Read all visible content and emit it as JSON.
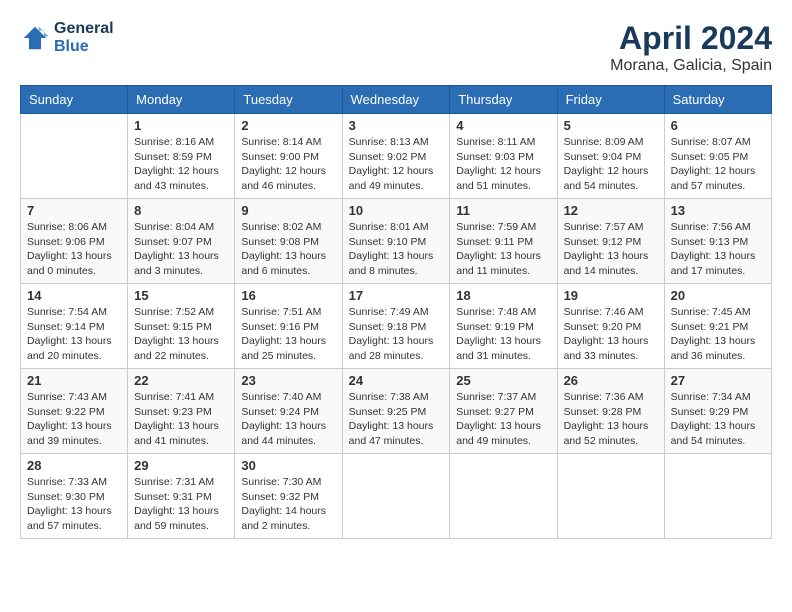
{
  "header": {
    "logo_line1": "General",
    "logo_line2": "Blue",
    "title": "April 2024",
    "location": "Morana, Galicia, Spain"
  },
  "days_of_week": [
    "Sunday",
    "Monday",
    "Tuesday",
    "Wednesday",
    "Thursday",
    "Friday",
    "Saturday"
  ],
  "weeks": [
    [
      {
        "day": "",
        "info": ""
      },
      {
        "day": "1",
        "info": "Sunrise: 8:16 AM\nSunset: 8:59 PM\nDaylight: 12 hours\nand 43 minutes."
      },
      {
        "day": "2",
        "info": "Sunrise: 8:14 AM\nSunset: 9:00 PM\nDaylight: 12 hours\nand 46 minutes."
      },
      {
        "day": "3",
        "info": "Sunrise: 8:13 AM\nSunset: 9:02 PM\nDaylight: 12 hours\nand 49 minutes."
      },
      {
        "day": "4",
        "info": "Sunrise: 8:11 AM\nSunset: 9:03 PM\nDaylight: 12 hours\nand 51 minutes."
      },
      {
        "day": "5",
        "info": "Sunrise: 8:09 AM\nSunset: 9:04 PM\nDaylight: 12 hours\nand 54 minutes."
      },
      {
        "day": "6",
        "info": "Sunrise: 8:07 AM\nSunset: 9:05 PM\nDaylight: 12 hours\nand 57 minutes."
      }
    ],
    [
      {
        "day": "7",
        "info": "Sunrise: 8:06 AM\nSunset: 9:06 PM\nDaylight: 13 hours\nand 0 minutes."
      },
      {
        "day": "8",
        "info": "Sunrise: 8:04 AM\nSunset: 9:07 PM\nDaylight: 13 hours\nand 3 minutes."
      },
      {
        "day": "9",
        "info": "Sunrise: 8:02 AM\nSunset: 9:08 PM\nDaylight: 13 hours\nand 6 minutes."
      },
      {
        "day": "10",
        "info": "Sunrise: 8:01 AM\nSunset: 9:10 PM\nDaylight: 13 hours\nand 8 minutes."
      },
      {
        "day": "11",
        "info": "Sunrise: 7:59 AM\nSunset: 9:11 PM\nDaylight: 13 hours\nand 11 minutes."
      },
      {
        "day": "12",
        "info": "Sunrise: 7:57 AM\nSunset: 9:12 PM\nDaylight: 13 hours\nand 14 minutes."
      },
      {
        "day": "13",
        "info": "Sunrise: 7:56 AM\nSunset: 9:13 PM\nDaylight: 13 hours\nand 17 minutes."
      }
    ],
    [
      {
        "day": "14",
        "info": "Sunrise: 7:54 AM\nSunset: 9:14 PM\nDaylight: 13 hours\nand 20 minutes."
      },
      {
        "day": "15",
        "info": "Sunrise: 7:52 AM\nSunset: 9:15 PM\nDaylight: 13 hours\nand 22 minutes."
      },
      {
        "day": "16",
        "info": "Sunrise: 7:51 AM\nSunset: 9:16 PM\nDaylight: 13 hours\nand 25 minutes."
      },
      {
        "day": "17",
        "info": "Sunrise: 7:49 AM\nSunset: 9:18 PM\nDaylight: 13 hours\nand 28 minutes."
      },
      {
        "day": "18",
        "info": "Sunrise: 7:48 AM\nSunset: 9:19 PM\nDaylight: 13 hours\nand 31 minutes."
      },
      {
        "day": "19",
        "info": "Sunrise: 7:46 AM\nSunset: 9:20 PM\nDaylight: 13 hours\nand 33 minutes."
      },
      {
        "day": "20",
        "info": "Sunrise: 7:45 AM\nSunset: 9:21 PM\nDaylight: 13 hours\nand 36 minutes."
      }
    ],
    [
      {
        "day": "21",
        "info": "Sunrise: 7:43 AM\nSunset: 9:22 PM\nDaylight: 13 hours\nand 39 minutes."
      },
      {
        "day": "22",
        "info": "Sunrise: 7:41 AM\nSunset: 9:23 PM\nDaylight: 13 hours\nand 41 minutes."
      },
      {
        "day": "23",
        "info": "Sunrise: 7:40 AM\nSunset: 9:24 PM\nDaylight: 13 hours\nand 44 minutes."
      },
      {
        "day": "24",
        "info": "Sunrise: 7:38 AM\nSunset: 9:25 PM\nDaylight: 13 hours\nand 47 minutes."
      },
      {
        "day": "25",
        "info": "Sunrise: 7:37 AM\nSunset: 9:27 PM\nDaylight: 13 hours\nand 49 minutes."
      },
      {
        "day": "26",
        "info": "Sunrise: 7:36 AM\nSunset: 9:28 PM\nDaylight: 13 hours\nand 52 minutes."
      },
      {
        "day": "27",
        "info": "Sunrise: 7:34 AM\nSunset: 9:29 PM\nDaylight: 13 hours\nand 54 minutes."
      }
    ],
    [
      {
        "day": "28",
        "info": "Sunrise: 7:33 AM\nSunset: 9:30 PM\nDaylight: 13 hours\nand 57 minutes."
      },
      {
        "day": "29",
        "info": "Sunrise: 7:31 AM\nSunset: 9:31 PM\nDaylight: 13 hours\nand 59 minutes."
      },
      {
        "day": "30",
        "info": "Sunrise: 7:30 AM\nSunset: 9:32 PM\nDaylight: 14 hours\nand 2 minutes."
      },
      {
        "day": "",
        "info": ""
      },
      {
        "day": "",
        "info": ""
      },
      {
        "day": "",
        "info": ""
      },
      {
        "day": "",
        "info": ""
      }
    ]
  ]
}
